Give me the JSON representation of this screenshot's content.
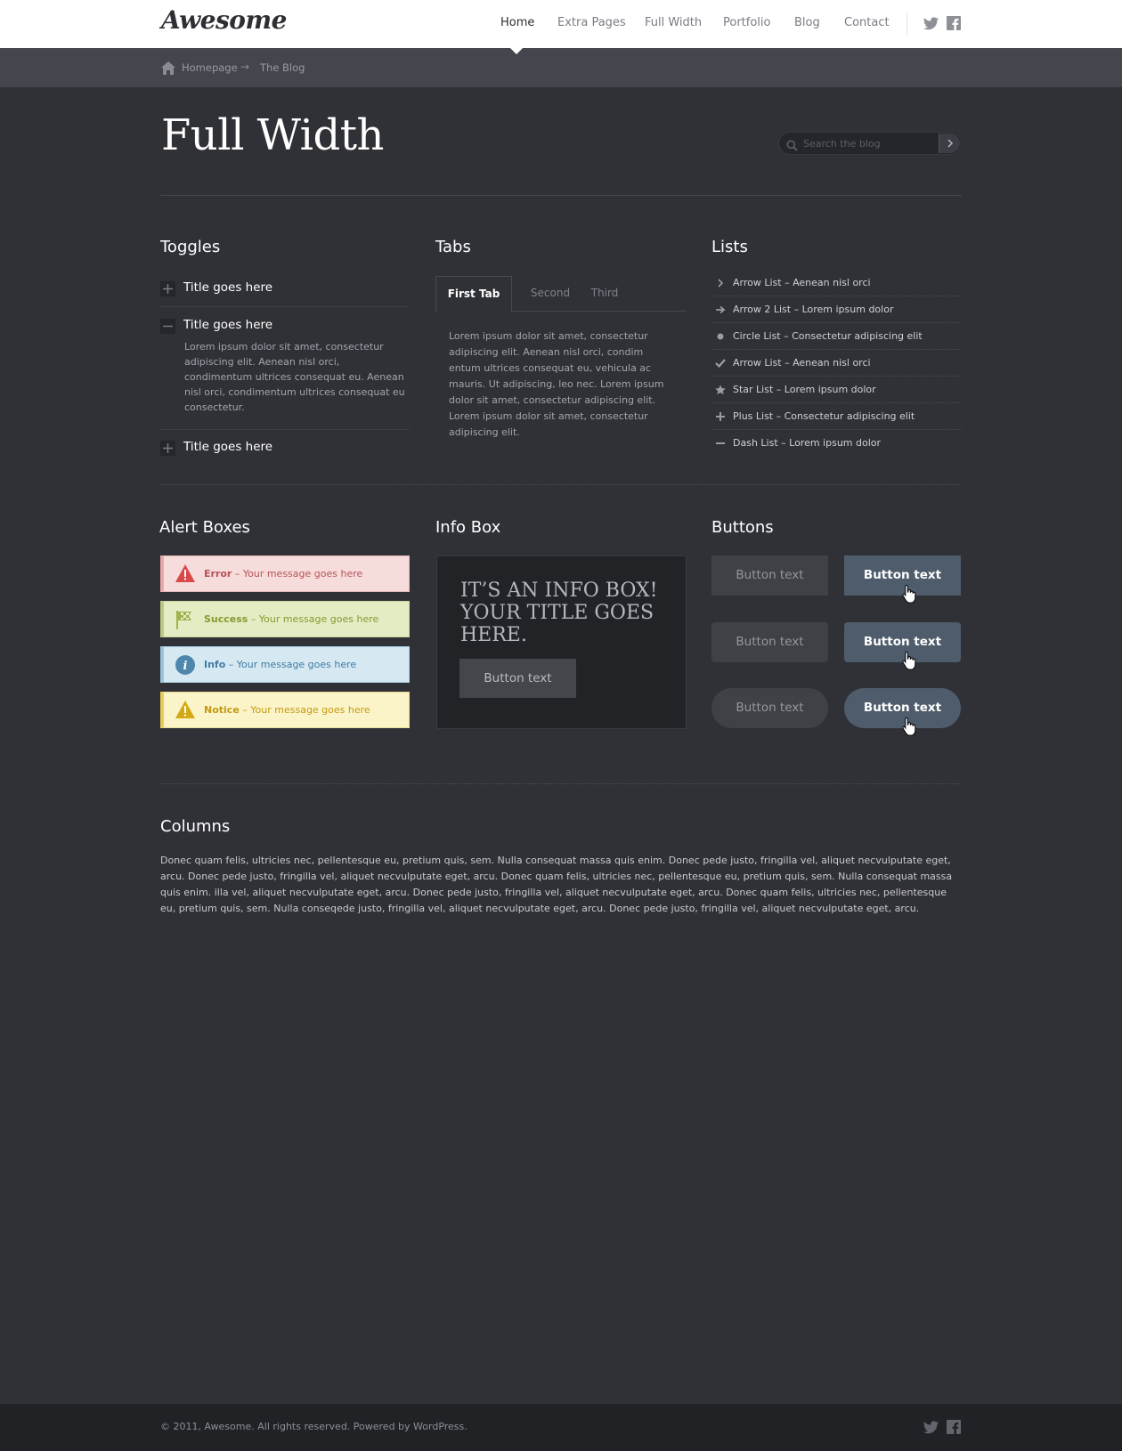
{
  "header": {
    "logo": "Awesome",
    "nav": [
      {
        "label": "Home",
        "active": true
      },
      {
        "label": "Extra Pages",
        "active": false
      },
      {
        "label": "Full Width",
        "active": false
      },
      {
        "label": "Portfolio",
        "active": false
      },
      {
        "label": "Blog",
        "active": false
      },
      {
        "label": "Contact",
        "active": false
      }
    ],
    "social": [
      "twitter-icon",
      "facebook-icon"
    ]
  },
  "breadcrumb": {
    "items": [
      "Homepage",
      "The Blog"
    ],
    "separator": "→"
  },
  "page": {
    "title": "Full Width",
    "search_placeholder": "Search the blog"
  },
  "toggles": {
    "heading": "Toggles",
    "items": [
      {
        "title": "Title goes here",
        "open": false
      },
      {
        "title": "Title goes here",
        "open": true,
        "body": "Lorem ipsum dolor sit amet, consectetur adipiscing elit. Aenean nisl orci, condimentum ultrices consequat eu. Aenean nisl orci, condimentum ultrices consequat eu consectetur."
      },
      {
        "title": "Title goes here",
        "open": false
      }
    ]
  },
  "tabs": {
    "heading": "Tabs",
    "labels": [
      "First Tab",
      "Second",
      "Third"
    ],
    "active": 0,
    "body": "Lorem ipsum dolor sit amet, consectetur adipiscing elit. Aenean nisl orci, condim entum ultrices consequat eu, vehicula ac mauris. Ut adipiscing, leo nec. Lorem ipsum dolor sit amet, consectetur adipiscing elit. Lorem ipsum dolor sit amet, consectetur adipiscing elit."
  },
  "lists": {
    "heading": "Lists",
    "items": [
      {
        "icon": "chevron-right-icon",
        "text": "Arrow List – Aenean nisl orci"
      },
      {
        "icon": "arrow-right-icon",
        "text": "Arrow 2 List – Lorem ipsum dolor"
      },
      {
        "icon": "circle-icon",
        "text": "Circle List – Consectetur adipiscing elit"
      },
      {
        "icon": "check-icon",
        "text": "Arrow List – Aenean nisl orci"
      },
      {
        "icon": "star-icon",
        "text": "Star List – Lorem ipsum dolor"
      },
      {
        "icon": "plus-icon",
        "text": "Plus List – Consectetur adipiscing elit"
      },
      {
        "icon": "dash-icon",
        "text": "Dash List – Lorem ipsum dolor"
      }
    ]
  },
  "alerts": {
    "heading": "Alert Boxes",
    "items": [
      {
        "type": "Error",
        "message": " – Your message goes here",
        "icon": "error-icon",
        "bg": "#f7dcdc",
        "border": "#e7b9b9",
        "accent": "#d84a4a",
        "color": "#b45357"
      },
      {
        "type": "Success",
        "message": " – Your message goes here",
        "icon": "flag-icon",
        "bg": "#e4ecc4",
        "border": "#c9d89b",
        "accent": "#9fb44e",
        "color": "#869a2e"
      },
      {
        "type": "Info",
        "message": " – Your message goes here",
        "icon": "info-icon",
        "bg": "#d6e9f3",
        "border": "#acd0e3",
        "accent": "#6fa8c8",
        "color": "#3f7ba0"
      },
      {
        "type": "Notice",
        "message": " – Your message goes here",
        "icon": "warning-icon",
        "bg": "#fbf4c8",
        "border": "#eadc95",
        "accent": "#e6c333",
        "color": "#c39a12"
      }
    ]
  },
  "infobox": {
    "heading": "Info Box",
    "title": "It’s an info box! Your title goes here.",
    "button": "Button text"
  },
  "buttons": {
    "heading": "Buttons",
    "labels": [
      "Button text",
      "Button text",
      "Button text",
      "Button text",
      "Button text",
      "Button text"
    ]
  },
  "columns": {
    "heading": "Columns",
    "text": "Donec quam felis, ultricies nec, pellentesque eu, pretium quis, sem. Nulla consequat massa quis enim. Donec pede justo, fringilla vel, aliquet necvulputate eget, arcu. Donec pede justo, fringilla vel, aliquet necvulputate eget, arcu. Donec quam felis, ultricies nec, pellentesque eu, pretium quis, sem. Nulla consequat massa quis enim. illa vel, aliquet necvulputate eget, arcu. Donec pede justo, fringilla vel, aliquet necvulputate eget, arcu. Donec quam felis, ultricies nec, pellentesque eu, pretium quis, sem. Nulla conseqede justo, fringilla vel, aliquet necvulputate eget, arcu. Donec pede justo, fringilla vel, aliquet necvulputate eget, arcu."
  },
  "footer": {
    "text": "© 2011, Awesome. All rights reserved. Powered by WordPress."
  },
  "colors": {
    "background": "#303137",
    "header": "#ffffff",
    "breadcrumb_bar": "#45464d",
    "footer": "#212226",
    "button_blue": "#4f5c6b",
    "button_dark": "#404147"
  }
}
